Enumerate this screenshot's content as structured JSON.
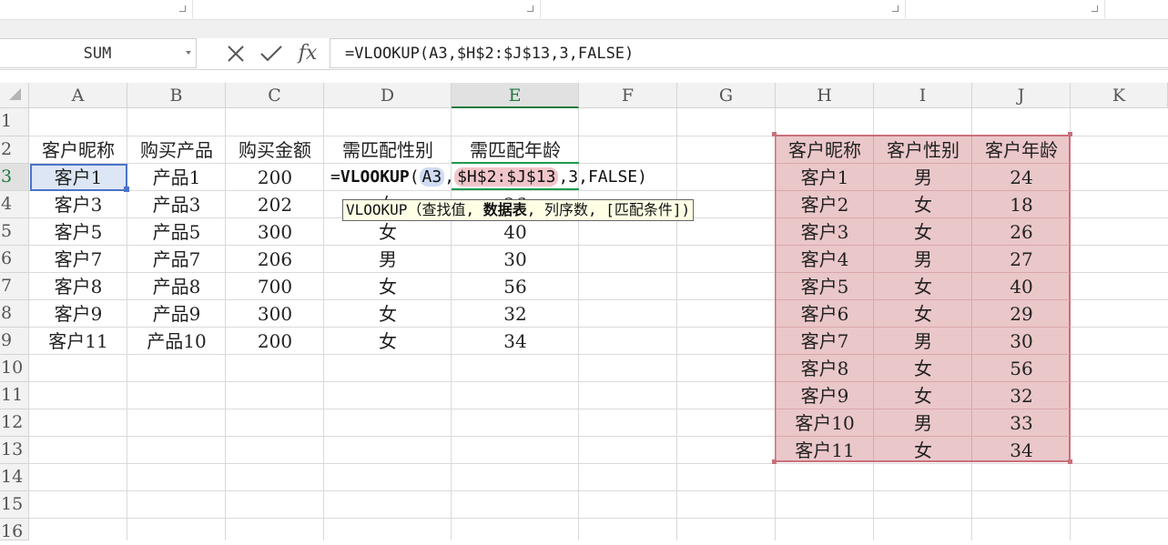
{
  "name_box": "SUM",
  "formula_bar": {
    "cancel_icon": "close-icon",
    "enter_icon": "check-icon",
    "fx_label": "fx",
    "formula": "=VLOOKUP(A3,$H$2:$J$13,3,FALSE)"
  },
  "columns": [
    "A",
    "B",
    "C",
    "D",
    "E",
    "F",
    "G",
    "H",
    "I",
    "J",
    "K"
  ],
  "rows": [
    "1",
    "2",
    "3",
    "4",
    "5",
    "6",
    "7",
    "8",
    "9",
    "10",
    "11",
    "12",
    "13",
    "14",
    "15",
    "16"
  ],
  "active_cell": "E3",
  "headers_row2": {
    "A": "客户昵称",
    "B": "购买产品",
    "C": "购买金额",
    "D": "需匹配性别",
    "E": "需匹配年龄"
  },
  "data_rows": [
    {
      "row": "3",
      "A": "客户1",
      "B": "产品1",
      "C": "200",
      "D": "",
      "E": ""
    },
    {
      "row": "4",
      "A": "客户3",
      "B": "产品3",
      "C": "202",
      "D": "女",
      "E": "26"
    },
    {
      "row": "5",
      "A": "客户5",
      "B": "产品5",
      "C": "300",
      "D": "女",
      "E": "40"
    },
    {
      "row": "6",
      "A": "客户7",
      "B": "产品7",
      "C": "206",
      "D": "男",
      "E": "30"
    },
    {
      "row": "7",
      "A": "客户8",
      "B": "产品8",
      "C": "700",
      "D": "女",
      "E": "56"
    },
    {
      "row": "8",
      "A": "客户9",
      "B": "产品9",
      "C": "300",
      "D": "女",
      "E": "32"
    },
    {
      "row": "9",
      "A": "客户11",
      "B": "产品10",
      "C": "200",
      "D": "女",
      "E": "34"
    }
  ],
  "editing_formula": {
    "prefix": "=",
    "fn": "VLOOKUP",
    "open": "(",
    "arg1": "A3",
    "comma1": ",",
    "arg2": "$H$2:$J$13",
    "rest": ",3,FALSE)"
  },
  "tooltip": {
    "fn": "VLOOKUP",
    "open": "（查找值,",
    "bold": "数据表",
    "rest": ", 列序数, [匹配条件])"
  },
  "ref_table": {
    "headers": [
      "客户昵称",
      "客户性别",
      "客户年龄"
    ],
    "rows": [
      [
        "客户1",
        "男",
        "24"
      ],
      [
        "客户2",
        "女",
        "18"
      ],
      [
        "客户3",
        "女",
        "26"
      ],
      [
        "客户4",
        "男",
        "27"
      ],
      [
        "客户5",
        "女",
        "40"
      ],
      [
        "客户6",
        "女",
        "29"
      ],
      [
        "客户7",
        "男",
        "30"
      ],
      [
        "客户8",
        "女",
        "56"
      ],
      [
        "客户9",
        "女",
        "32"
      ],
      [
        "客户10",
        "男",
        "33"
      ],
      [
        "客户11",
        "女",
        "34"
      ]
    ]
  },
  "colors": {
    "selection": "#4a74c9",
    "active_header": "#1f7a3e",
    "ref_fill": "#eac7c9",
    "ref_border": "#c9707a"
  }
}
